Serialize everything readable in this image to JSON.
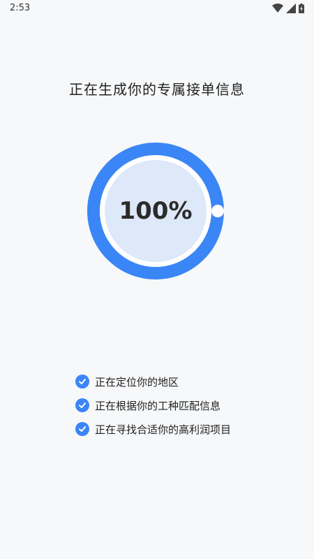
{
  "status": {
    "time": "2:53",
    "icons": [
      "wifi-icon",
      "signal-icon",
      "battery-icon"
    ]
  },
  "title": "正在生成你的专属接单信息",
  "progress": {
    "percent": 100,
    "label": "100%",
    "ring_color": "#3b86f6",
    "inner_color": "#dde8f8"
  },
  "steps": [
    {
      "label": "正在定位你的地区",
      "done": true
    },
    {
      "label": "正在根据你的工种匹配信息",
      "done": true
    },
    {
      "label": "正在寻找合适你的高利润项目",
      "done": true
    }
  ]
}
